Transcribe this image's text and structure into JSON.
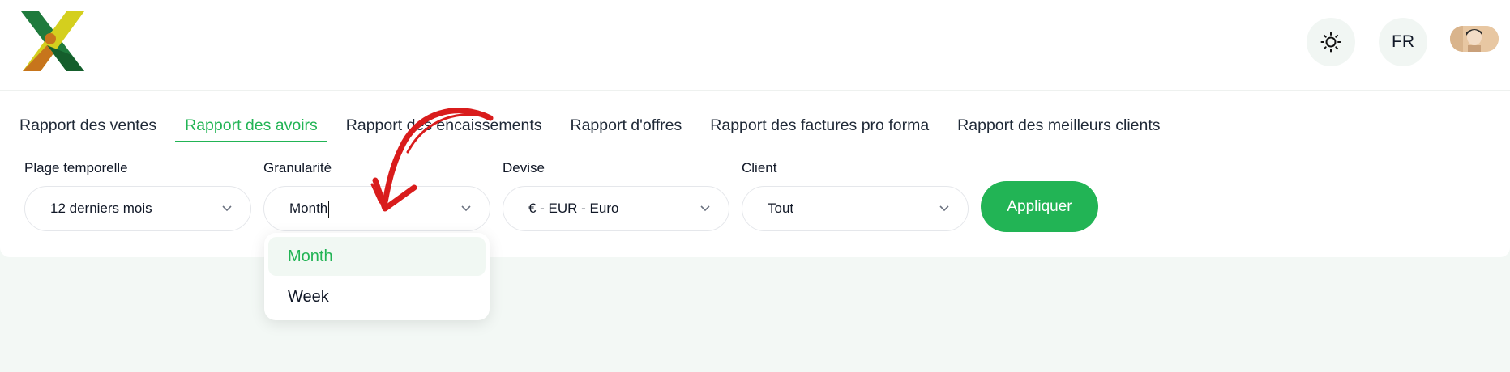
{
  "header": {
    "logo_icon": "app-logo-icon",
    "theme_icon": "sun-icon",
    "language": "FR",
    "avatar_icon": "user-avatar"
  },
  "tabs": [
    {
      "label": "Rapport des ventes",
      "active": false
    },
    {
      "label": "Rapport des avoirs",
      "active": true
    },
    {
      "label": "Rapport des encaissements",
      "active": false
    },
    {
      "label": "Rapport d'offres",
      "active": false
    },
    {
      "label": "Rapport des factures pro forma",
      "active": false
    },
    {
      "label": "Rapport des meilleurs clients",
      "active": false
    }
  ],
  "filters": {
    "time_range": {
      "label": "Plage temporelle",
      "value": "12 derniers mois"
    },
    "granularity": {
      "label": "Granularité",
      "value": "Month"
    },
    "currency": {
      "label": "Devise",
      "value": "€ - EUR - Euro"
    },
    "client": {
      "label": "Client",
      "value": "Tout"
    }
  },
  "apply_label": "Appliquer",
  "granularity_options": [
    {
      "label": "Month",
      "selected": true
    },
    {
      "label": "Week",
      "selected": false
    }
  ],
  "colors": {
    "accent": "#22b455",
    "annotation_arrow": "#d91c1c",
    "background": "#f3f8f5"
  }
}
